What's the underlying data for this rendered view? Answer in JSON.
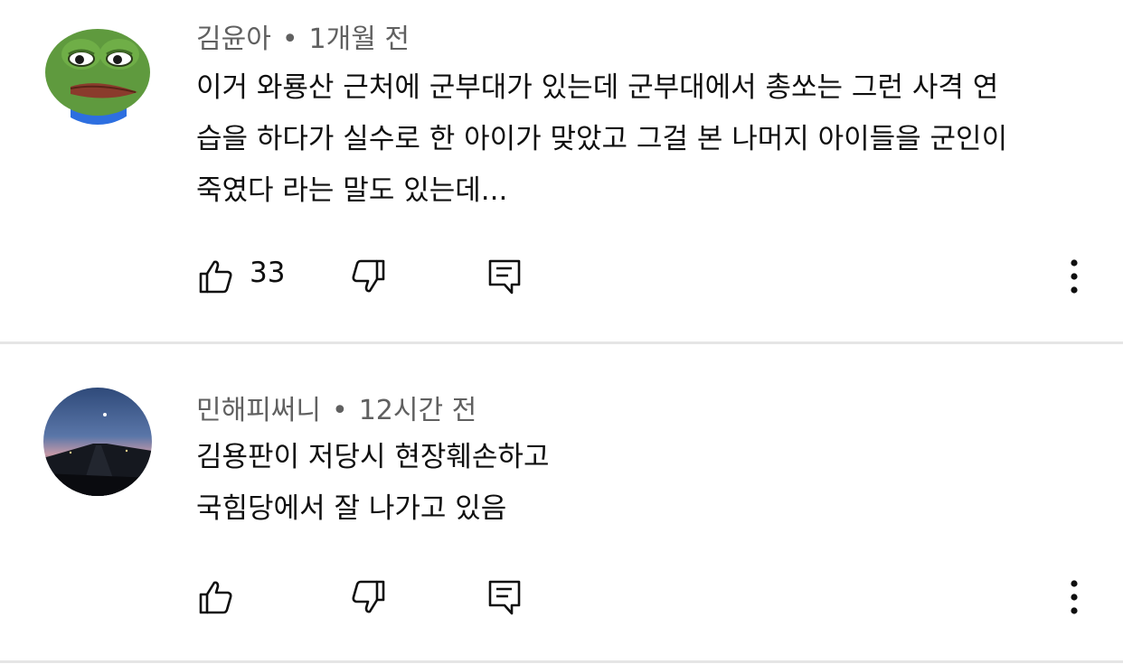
{
  "comments": [
    {
      "author": "김윤아",
      "separator": "•",
      "time": "1개월 전",
      "lines": [
        "이거 와룡산 근처에 군부대가 있는데 군부대에서 총쏘는 그런 사격 연",
        "습을 하다가 실수로 한 아이가 맞았고 그걸 본 나머지 아이들을 군인이",
        "죽였다 라는 말도 있는데..."
      ],
      "like_count": "33",
      "avatar_icon": "frog-avatar-icon"
    },
    {
      "author": "민해피써니",
      "separator": "•",
      "time": "12시간 전",
      "lines": [
        "김용판이 저당시 현장훼손하고",
        "국힘당에서 잘 나가고 있음"
      ],
      "like_count": "",
      "avatar_icon": "night-road-avatar-icon"
    }
  ],
  "colors": {
    "meta_text": "#606060",
    "body_text": "#0f0f0f",
    "divider": "#e5e5e5"
  }
}
